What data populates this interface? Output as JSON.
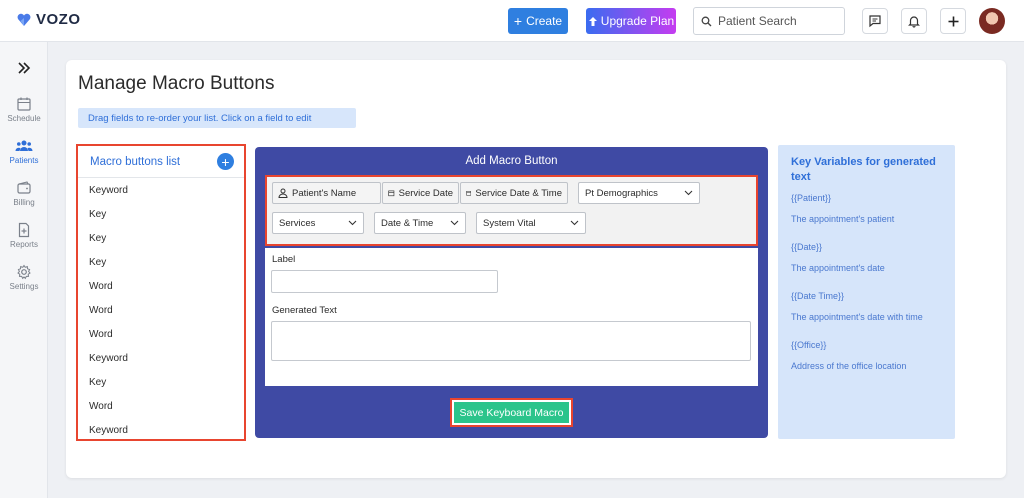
{
  "header": {
    "brand": "VOZO",
    "create_label": "Create",
    "upgrade_label": "Upgrade Plan",
    "search_placeholder": "Patient Search"
  },
  "sidebar": {
    "items": [
      {
        "label": "Schedule",
        "icon": "calendar-icon"
      },
      {
        "label": "Patients",
        "icon": "patients-icon",
        "active": true
      },
      {
        "label": "Billing",
        "icon": "wallet-icon"
      },
      {
        "label": "Reports",
        "icon": "report-icon"
      },
      {
        "label": "Settings",
        "icon": "gear-icon"
      }
    ]
  },
  "page": {
    "title": "Manage Macro Buttons",
    "hint": "Drag fields to re-order your list. Click on a field to edit"
  },
  "macro_list": {
    "title": "Macro buttons list",
    "items": [
      "Keyword",
      "Key",
      "Key",
      "Key",
      "Word",
      "Word",
      "Word",
      "Keyword",
      "Key",
      "Word",
      "Keyword"
    ]
  },
  "add_panel": {
    "title": "Add Macro Button",
    "chips": {
      "patient_name": "Patient's Name",
      "service_date": "Service Date",
      "service_date_time": "Service Date & Time"
    },
    "selects": {
      "pt_demographics": "Pt Demographics",
      "services": "Services",
      "date_time": "Date & Time",
      "system_vital": "System Vital"
    },
    "label_field": "Label",
    "generated_text_field": "Generated Text",
    "save_label": "Save Keyboard Macro"
  },
  "key_variables": {
    "title": "Key Variables for generated text",
    "entries": [
      {
        "name": "{{Patient}}",
        "desc": "The appointment's patient"
      },
      {
        "name": "{{Date}}",
        "desc": "The appointment's date"
      },
      {
        "name": "{{Date Time}}",
        "desc": "The appointment's date with time"
      },
      {
        "name": "{{Office}}",
        "desc": "Address of the office location"
      }
    ]
  },
  "colors": {
    "accent": "#2f7fe0",
    "panel": "#3f4aa4",
    "highlight_border": "#e8452f",
    "save_green": "#2bc48b"
  }
}
